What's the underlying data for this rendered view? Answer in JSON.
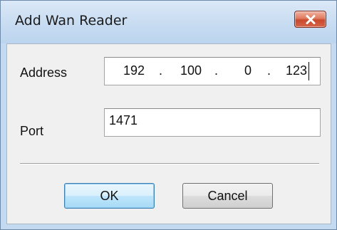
{
  "window": {
    "title": "Add Wan Reader",
    "close_icon": "close-x-icon",
    "accent_color": "#c84a2d"
  },
  "form": {
    "address_label": "Address",
    "address_octets": [
      "192",
      "100",
      "0",
      "123"
    ],
    "address_separator": ".",
    "port_label": "Port",
    "port_value": "1471"
  },
  "buttons": {
    "ok_label": "OK",
    "cancel_label": "Cancel"
  }
}
